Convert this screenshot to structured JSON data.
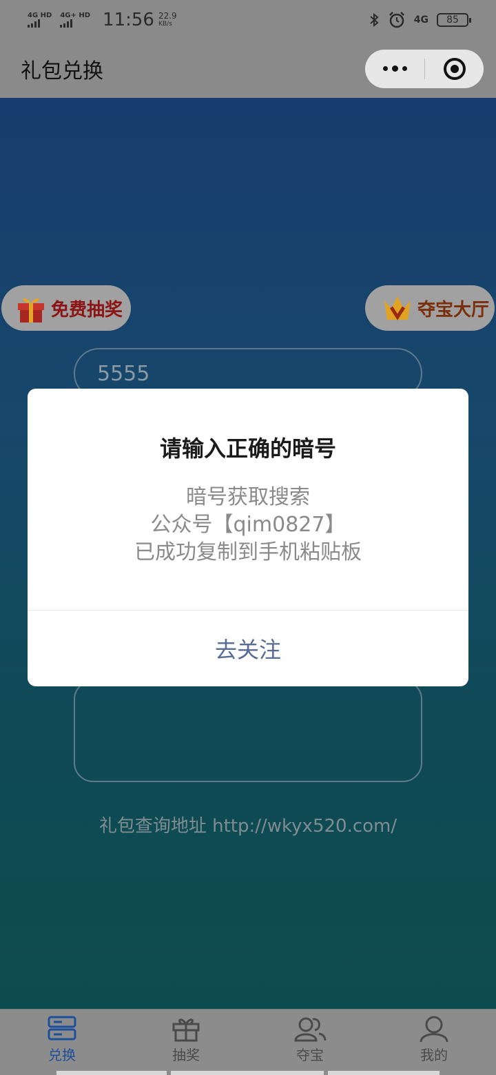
{
  "status_bar": {
    "signal1": "4G HD",
    "signal2": "4G+ HD",
    "time": "11:56",
    "net_speed": "22.9",
    "net_unit": "KB/s",
    "network_type": "4G",
    "battery": "85"
  },
  "header": {
    "title": "礼包兑换",
    "menu_icon": "more-dots-icon",
    "close_icon": "target-close-icon"
  },
  "main": {
    "free_lottery_label": "免费抽奖",
    "treasure_hall_label": "夺宝大厅",
    "code_input_value": "5555",
    "gift_address": "礼包查询地址 http://wkyx520.com/"
  },
  "dialog": {
    "title": "请输入正确的暗号",
    "lines": [
      "暗号获取搜索",
      "公众号【qim0827】",
      "已成功复制到手机粘贴板"
    ],
    "action_label": "去关注"
  },
  "tab_bar": {
    "items": [
      {
        "label": "兑换",
        "icon": "exchange-icon",
        "active": true
      },
      {
        "label": "抽奖",
        "icon": "gift-icon",
        "active": false
      },
      {
        "label": "夺宝",
        "icon": "people-icon",
        "active": false
      },
      {
        "label": "我的",
        "icon": "user-icon",
        "active": false
      }
    ]
  },
  "colors": {
    "accent_blue": "#1c4f9a",
    "dialog_action": "#576b95",
    "overlay_gray": "#8a8a8a"
  }
}
